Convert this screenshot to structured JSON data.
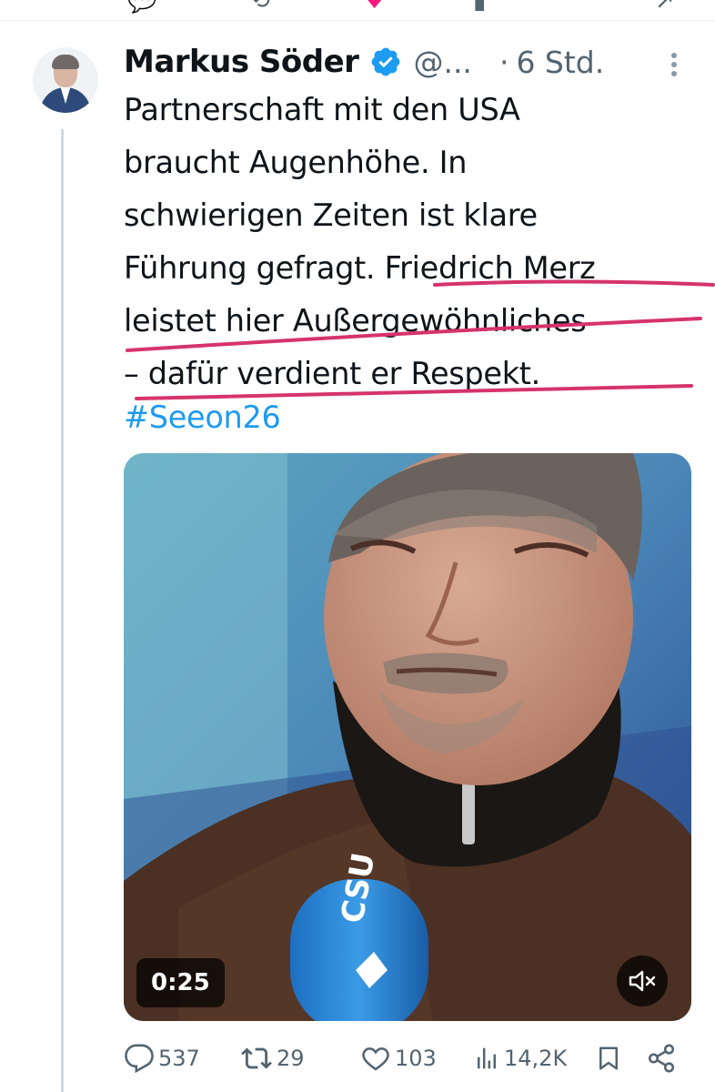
{
  "top_actions": [
    "💬",
    "⟲",
    "♥",
    "📊",
    "↗"
  ],
  "tweet": {
    "author_name": "Markus Söder",
    "handle": "@...",
    "separator": "·",
    "time": "6 Std.",
    "text": "Partnerschaft mit den USA\nbraucht Augenhöhe. In\nschwierigen Zeiten ist klare\nFührung gefragt. Friedrich Merz\nleistet hier Außergewöhnliches\n– dafür verdient er Respekt.",
    "hashtag": "#Seeon26",
    "avatar_icon": "profile-photo",
    "verified_icon": "verified-badge-icon",
    "more_icon": "more-vertical-icon"
  },
  "video": {
    "duration": "0:25",
    "mute_icon": "volume-muted-icon",
    "microphone_logo": "CSU"
  },
  "actions": {
    "replies": "537",
    "reposts": "29",
    "likes": "103",
    "views": "14,2K"
  },
  "colors": {
    "text": "#0f1419",
    "secondary": "#536471",
    "link": "#1d9bf0",
    "verified": "#1d9bf0",
    "highlight": "#d6336c"
  }
}
